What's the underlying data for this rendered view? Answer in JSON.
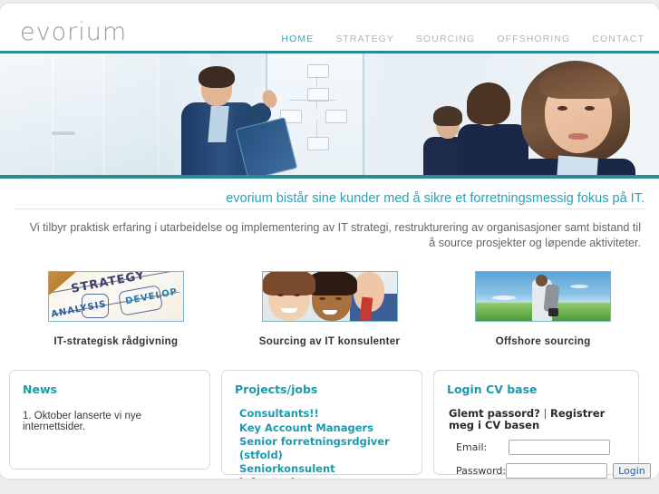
{
  "site": {
    "logo": "evorium"
  },
  "nav": {
    "items": [
      {
        "label": "HOME",
        "active": true
      },
      {
        "label": "STRATEGY",
        "active": false
      },
      {
        "label": "SOURCING",
        "active": false
      },
      {
        "label": "OFFSHORING",
        "active": false
      },
      {
        "label": "CONTACT",
        "active": false
      }
    ]
  },
  "hero": {
    "alt": "business people in an office with flowchart whiteboard"
  },
  "main": {
    "tagline": "evorium bistår sine kunder med å sikre et forretningsmessig fokus på IT.",
    "intro": "Vi tilbyr praktisk erfaring i utarbeidelse og implementering av IT strategi, restrukturering av organisasjoner samt bistand til å source prosjekter og løpende aktiviteter."
  },
  "services": [
    {
      "label": "IT-strategisk rådgivning",
      "thumb": "strategy-notes-thumbnail",
      "words": [
        "STRATEGY",
        "DEVELOP",
        "ANALYSIS"
      ]
    },
    {
      "label": "Sourcing av IT konsulenter",
      "thumb": "smiling-people-thumbnail"
    },
    {
      "label": "Offshore sourcing",
      "thumb": "man-in-field-thumbnail"
    }
  ],
  "news": {
    "title": "News",
    "items": [
      "1. Oktober lanserte vi nye internettsider."
    ]
  },
  "jobs": {
    "title": "Projects/jobs",
    "links": [
      "Consultants!!",
      "Key Account Managers",
      "Senior forretningsrdgiver (stfold)",
      "Seniorkonsulent infrastruktur"
    ]
  },
  "login": {
    "title": "Login CV base",
    "forgot_label": "Glemt passord?",
    "separator": " | ",
    "register_label": "Registrer meg i CV basen",
    "email_label": "Email:",
    "email_value": "",
    "email_placeholder": "",
    "password_label": "Password:",
    "password_value": "",
    "password_placeholder": "",
    "submit_label": "Login"
  },
  "colors": {
    "accent_teal": "#2a9fb6",
    "hero_border": "#2a8a96",
    "link_teal": "#1c9aad",
    "nav_inactive": "#b4b4b4",
    "page_background": "#eeeeee"
  }
}
